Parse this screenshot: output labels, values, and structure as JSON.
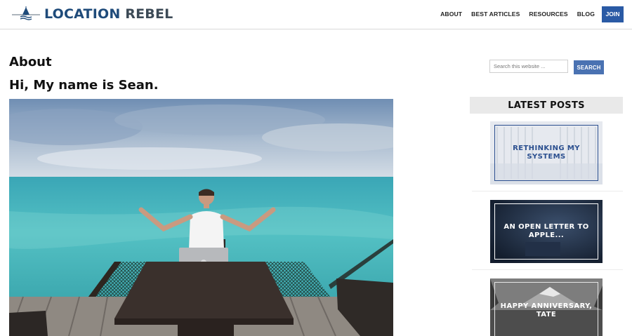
{
  "header": {
    "logo": {
      "word1": "LOCATION",
      "word2": "REBEL"
    },
    "nav": [
      "ABOUT",
      "BEST ARTICLES",
      "RESOURCES",
      "BLOG"
    ],
    "join_label": "JOIN",
    "colors": {
      "logo_blue": "#1f4b7a",
      "join_bg": "#2a5aa5"
    }
  },
  "main": {
    "page_title": "About",
    "heading": "Hi, My name is Sean."
  },
  "sidebar": {
    "search": {
      "placeholder": "Search this website ...",
      "value": "",
      "button_label": "SEARCH"
    },
    "latest_posts": {
      "title": "LATEST POSTS",
      "posts": [
        {
          "title": "RETHINKING MY SYSTEMS"
        },
        {
          "title": "AN OPEN LETTER TO APPLE..."
        },
        {
          "title": "HAPPY ANNIVERSARY, TATE"
        }
      ]
    }
  }
}
